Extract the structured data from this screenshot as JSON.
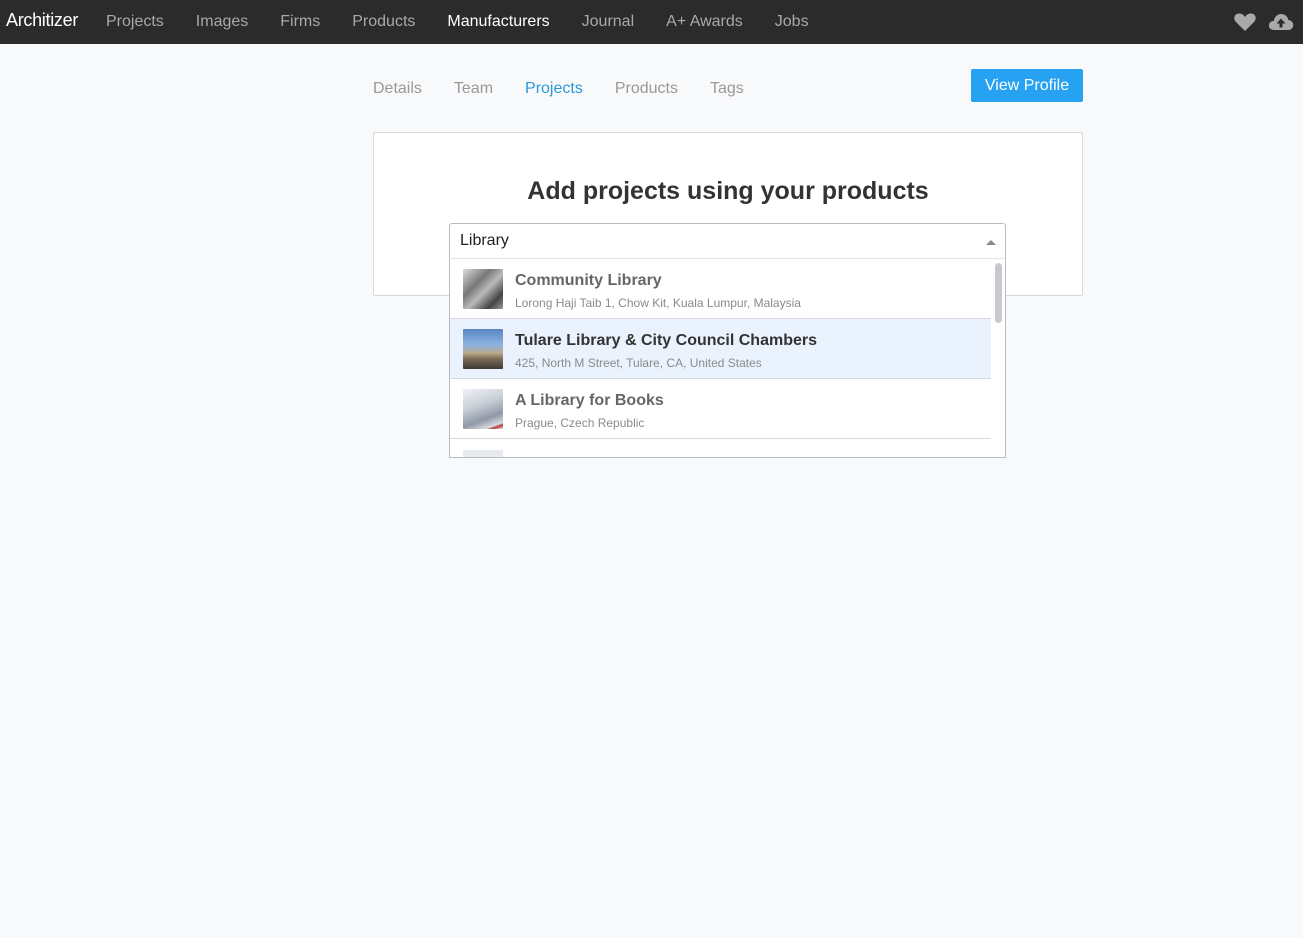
{
  "topnav": {
    "logo": "Architizer",
    "links": [
      {
        "label": "Projects",
        "active": false
      },
      {
        "label": "Images",
        "active": false
      },
      {
        "label": "Firms",
        "active": false
      },
      {
        "label": "Products",
        "active": false
      },
      {
        "label": "Manufacturers",
        "active": true
      },
      {
        "label": "Journal",
        "active": false
      },
      {
        "label": "A+ Awards",
        "active": false
      },
      {
        "label": "Jobs",
        "active": false
      }
    ],
    "icons": [
      "heart-icon",
      "cloud-upload-icon"
    ],
    "bg_color": "#2b2b2b"
  },
  "subtabs": [
    {
      "label": "Details",
      "active": false
    },
    {
      "label": "Team",
      "active": false
    },
    {
      "label": "Projects",
      "active": true
    },
    {
      "label": "Products",
      "active": false
    },
    {
      "label": "Tags",
      "active": false
    }
  ],
  "view_profile_label": "View Profile",
  "accent_color": "#27a2f2",
  "card": {
    "title": "Add projects using your products"
  },
  "search": {
    "value": "Library",
    "options": [
      {
        "title": "Community Library",
        "subtitle": "Lorong Haji Taib 1, Chow Kit, Kuala Lumpur, Malaysia",
        "highlighted": false
      },
      {
        "title": "Tulare Library & City Council Chambers",
        "subtitle": "425, North M Street, Tulare, CA, United States",
        "highlighted": true
      },
      {
        "title": "A Library for Books",
        "subtitle": "Prague, Czech Republic",
        "highlighted": false
      }
    ]
  }
}
